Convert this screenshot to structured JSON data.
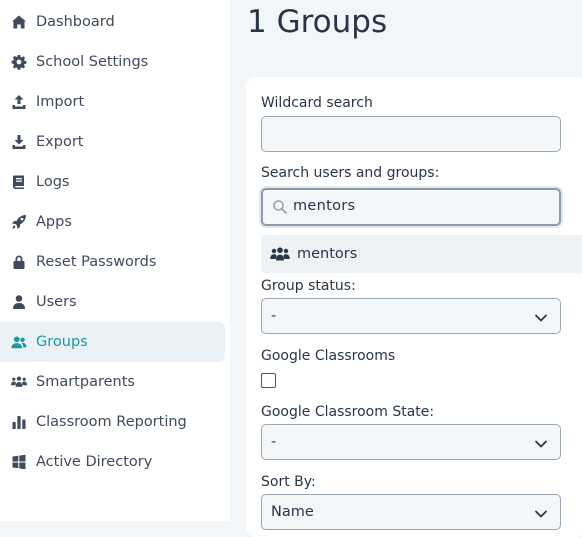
{
  "sidebar": {
    "items": [
      {
        "label": "Dashboard",
        "icon": "home-icon"
      },
      {
        "label": "School Settings",
        "icon": "gear-icon"
      },
      {
        "label": "Import",
        "icon": "upload-icon"
      },
      {
        "label": "Export",
        "icon": "download-icon"
      },
      {
        "label": "Logs",
        "icon": "book-icon"
      },
      {
        "label": "Apps",
        "icon": "rocket-icon"
      },
      {
        "label": "Reset Passwords",
        "icon": "lock-icon"
      },
      {
        "label": "Users",
        "icon": "user-icon"
      },
      {
        "label": "Groups",
        "icon": "users-icon",
        "active": true
      },
      {
        "label": "Smartparents",
        "icon": "people-group-icon"
      },
      {
        "label": "Classroom Reporting",
        "icon": "bar-chart-icon"
      },
      {
        "label": "Active Directory",
        "icon": "windows-icon"
      }
    ]
  },
  "page": {
    "title": "1 Groups"
  },
  "filters": {
    "wildcard_label": "Wildcard search",
    "wildcard_value": "",
    "search_label": "Search users and groups:",
    "search_value": "mentors",
    "dropdown_option": "mentors",
    "group_status_label": "Group status:",
    "group_status_value": "-",
    "google_classrooms_label": "Google Classrooms",
    "google_classrooms_checked": false,
    "classroom_state_label": "Google Classroom State:",
    "classroom_state_value": "-",
    "sort_by_label": "Sort By:",
    "sort_by_value": "Name"
  },
  "colors": {
    "accent": "#1a98a6",
    "active_bg": "#eaf2f5",
    "page_bg": "#f2f6f8"
  }
}
